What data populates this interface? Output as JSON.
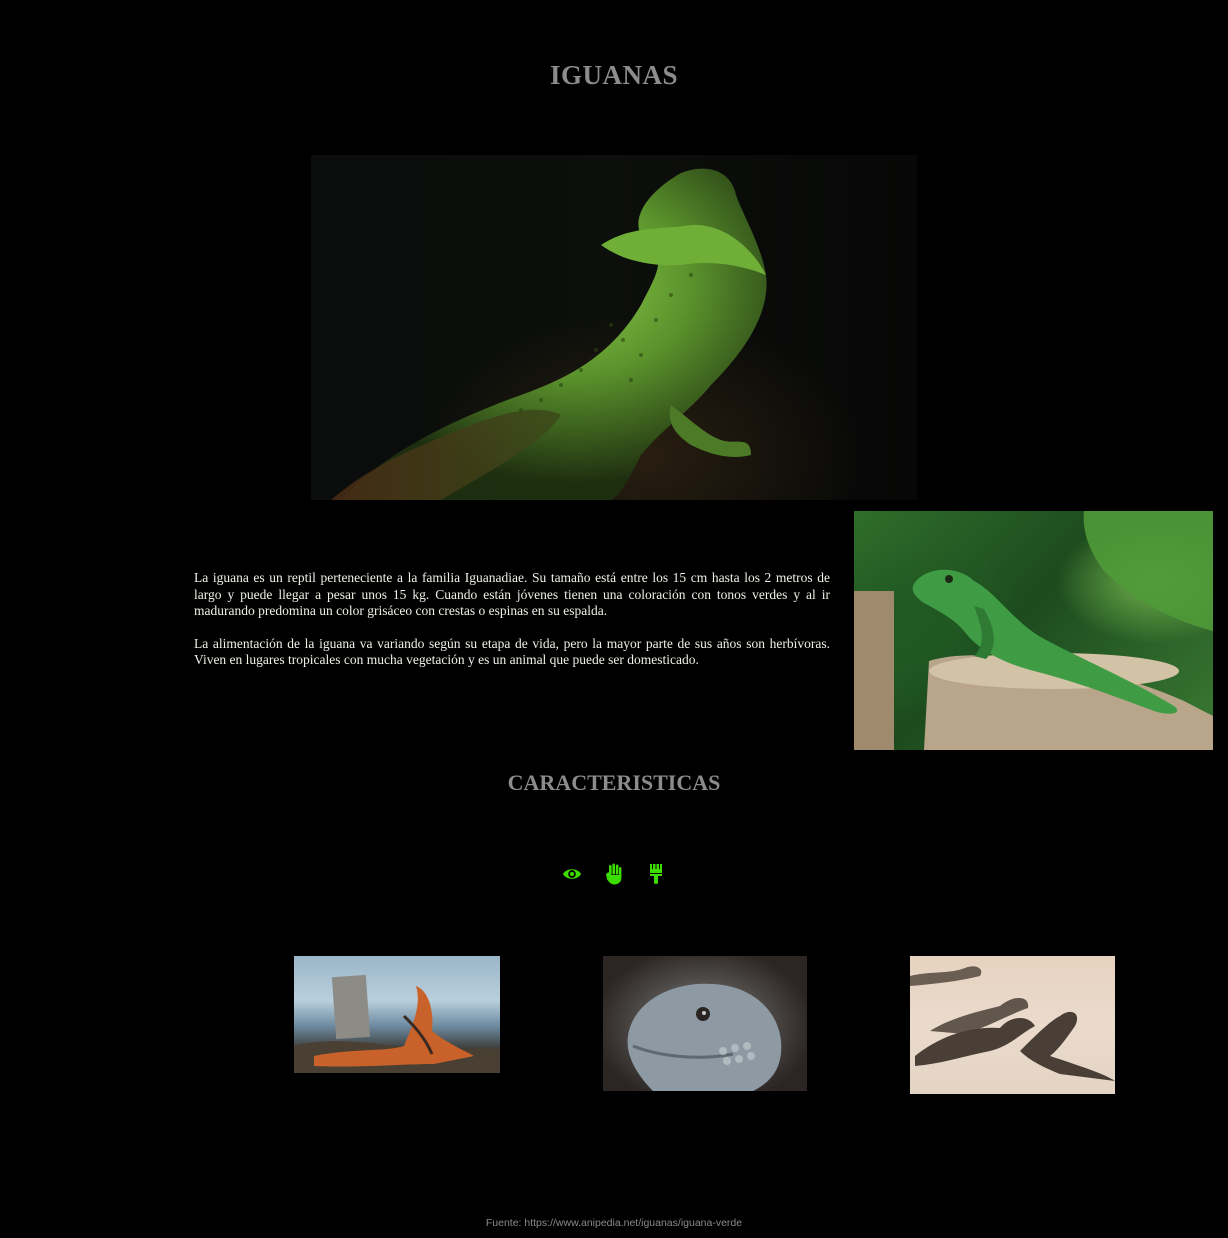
{
  "page": {
    "title": "IGUANAS",
    "section_title": "CARACTERISTICAS"
  },
  "intro": {
    "paragraphs": [
      "La iguana es un reptil perteneciente a la familia Iguanadiae. Su tamaño está entre los 15 cm hasta los 2 metros de largo y puede llegar a pesar unos 15 kg. Cuando están jóvenes tienen una coloración con tonos verdes y al ir madurando predomina un color grisáceo con crestas o espinas en su espalda.",
      "La alimentación de la iguana va variando según su etapa de vida, pero la mayor parte de sus años son herbívoras. Viven en lugares tropicales con mucha vegetación y es un animal que puede ser domesticado."
    ]
  },
  "feature_icons": [
    {
      "icon": "eye-icon",
      "color": "#3ddc00"
    },
    {
      "icon": "hand-icon",
      "color": "#3ddc00"
    },
    {
      "icon": "brush-icon",
      "color": "#3ddc00"
    }
  ],
  "images": {
    "hero": "green-lizard-dark-photo",
    "side": "green-iguana-on-stump-photo",
    "gallery": [
      "orange-iguana-by-sea-photo",
      "gray-iguana-head-photo",
      "iguanas-on-sand-photo"
    ]
  },
  "footer": {
    "source": "Fuente: https://www.anipedia.net/iguanas/iguana-verde"
  },
  "colors": {
    "background": "#000000",
    "heading": "#8c8c8c",
    "accent": "#3ddc00"
  }
}
